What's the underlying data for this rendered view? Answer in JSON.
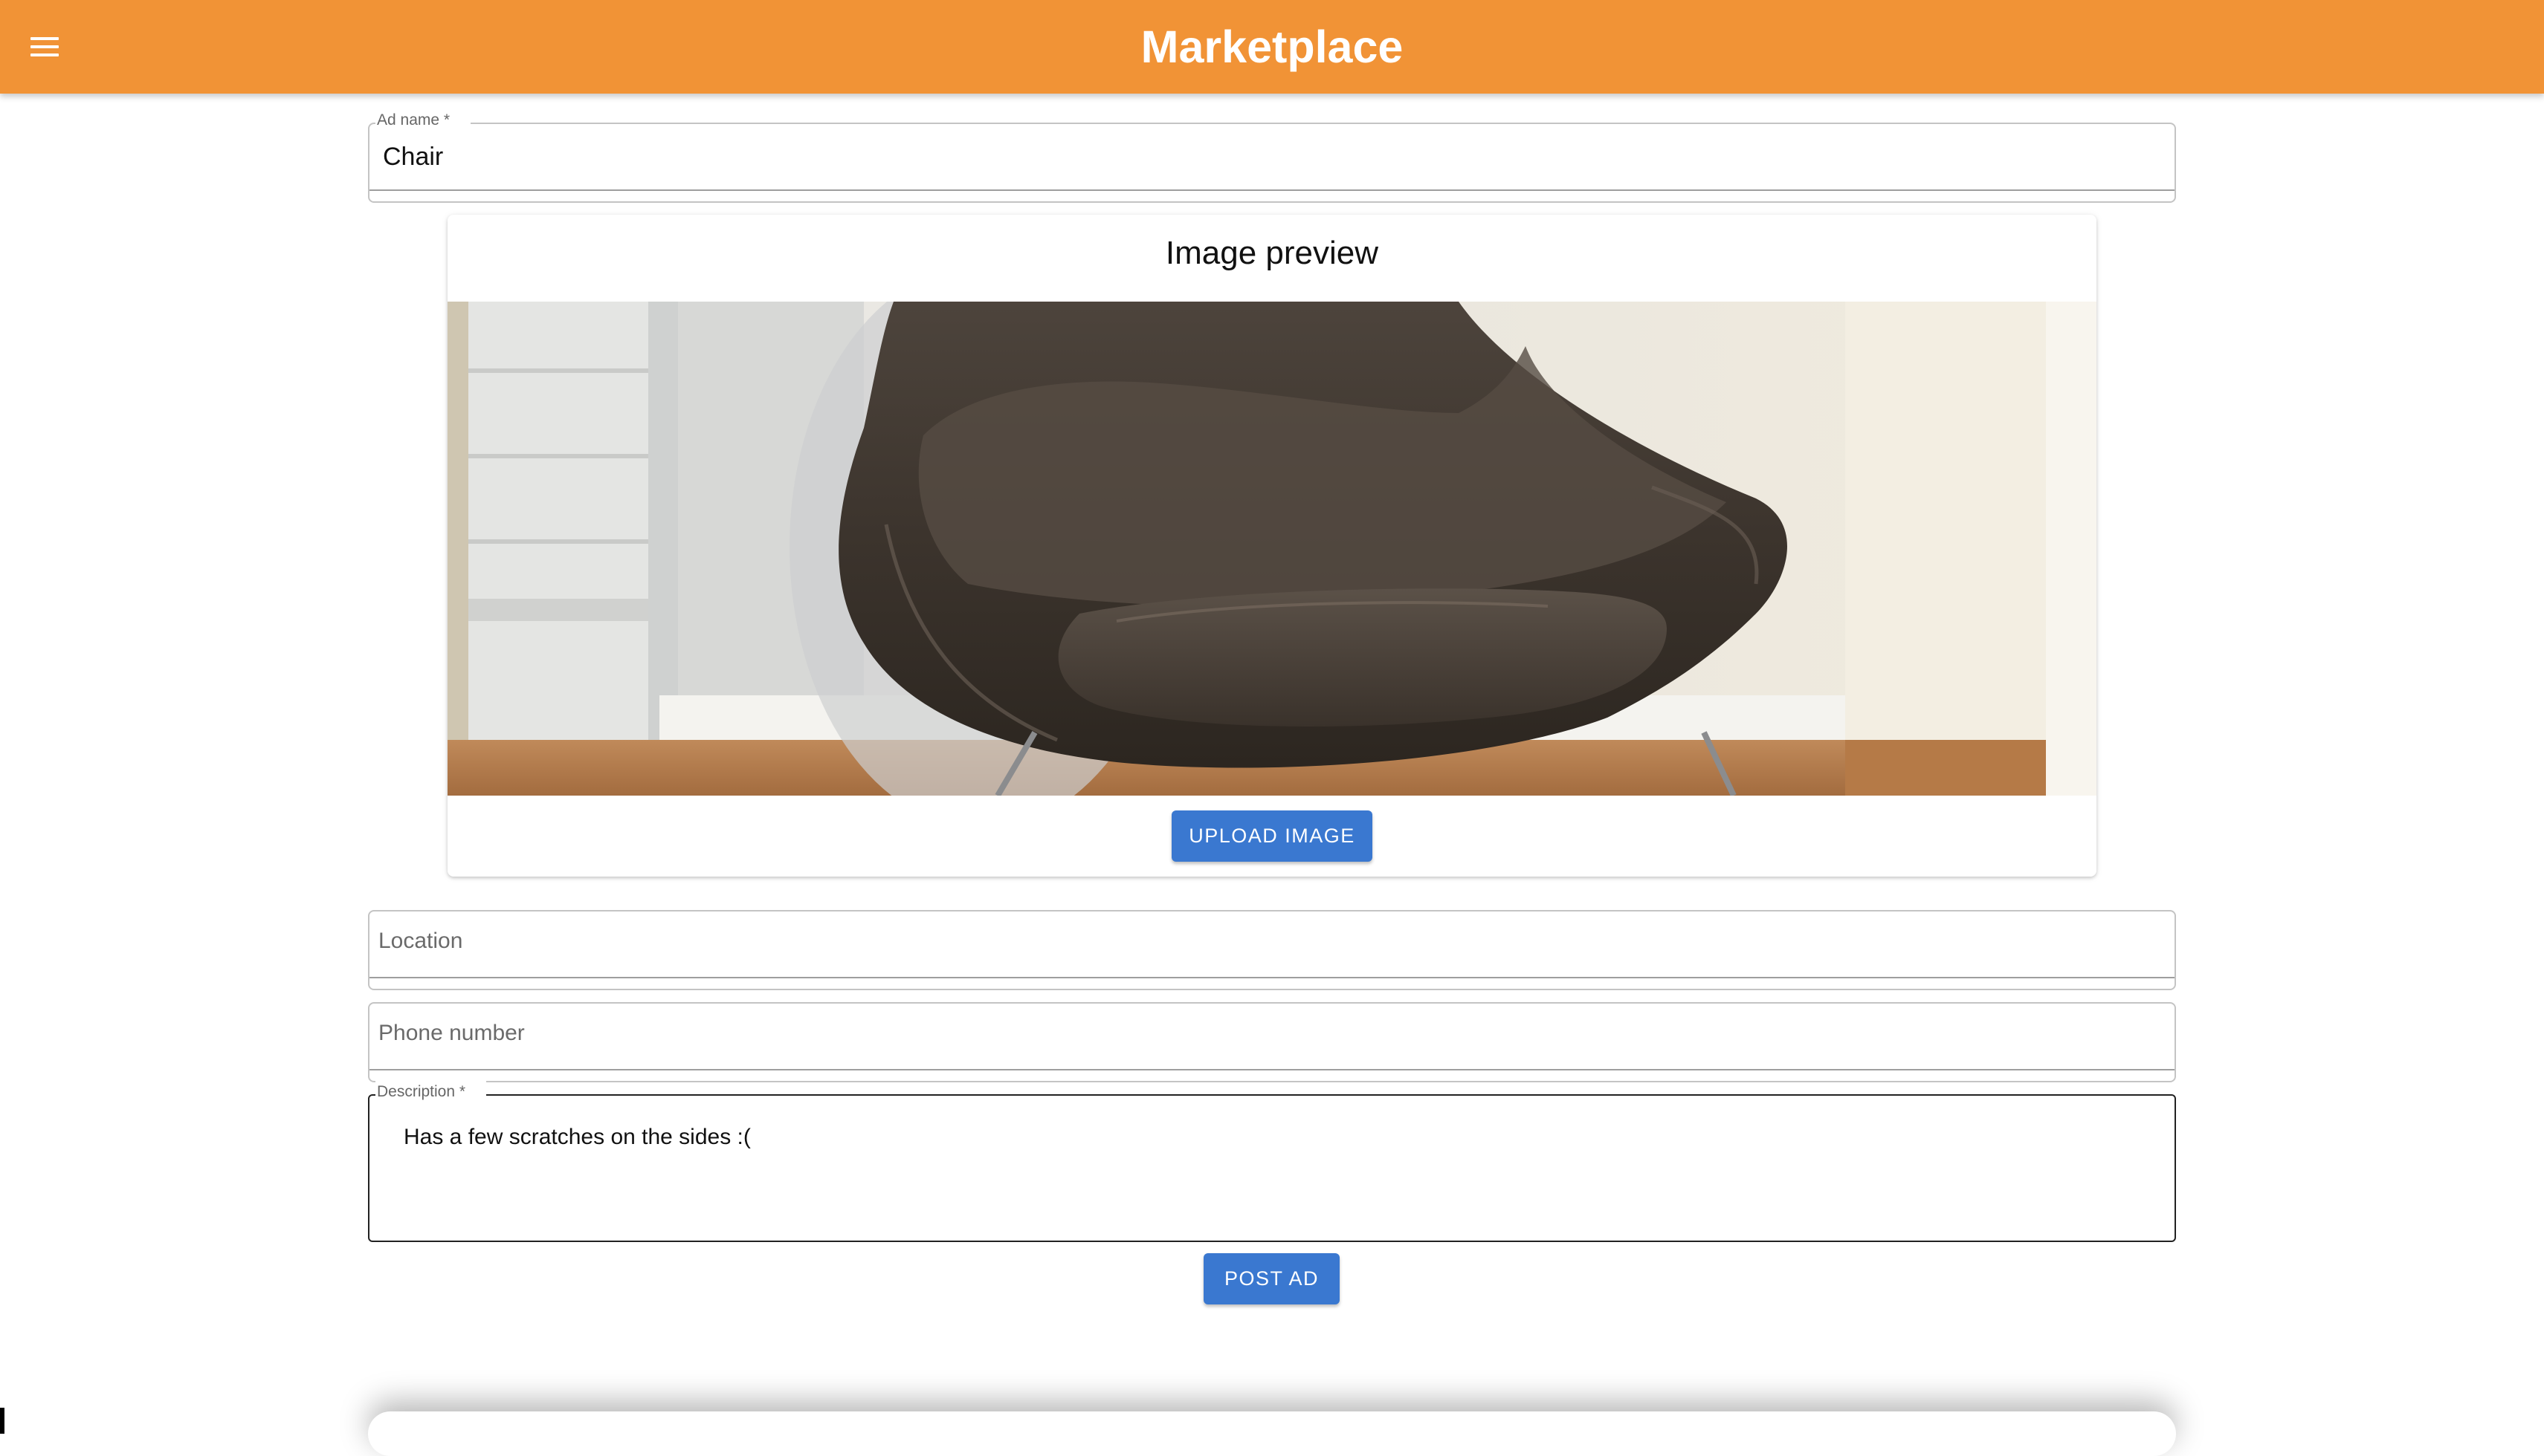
{
  "app_bar": {
    "title": "Marketplace",
    "menu_icon": "menu-icon",
    "color": "#f19336"
  },
  "form": {
    "ad_name": {
      "label": "Ad name *",
      "value": "Chair"
    },
    "image_preview": {
      "title": "Image preview",
      "image": "leather-chair-photo",
      "upload_label": "UPLOAD IMAGE"
    },
    "location": {
      "placeholder": "Location",
      "value": ""
    },
    "phone": {
      "placeholder": "Phone number",
      "value": ""
    },
    "description": {
      "label": "Description *",
      "value": "Has a few scratches on the sides :("
    },
    "submit_label": "POST AD"
  },
  "colors": {
    "primary_button": "#3a78d0",
    "app_bar": "#f19336"
  }
}
